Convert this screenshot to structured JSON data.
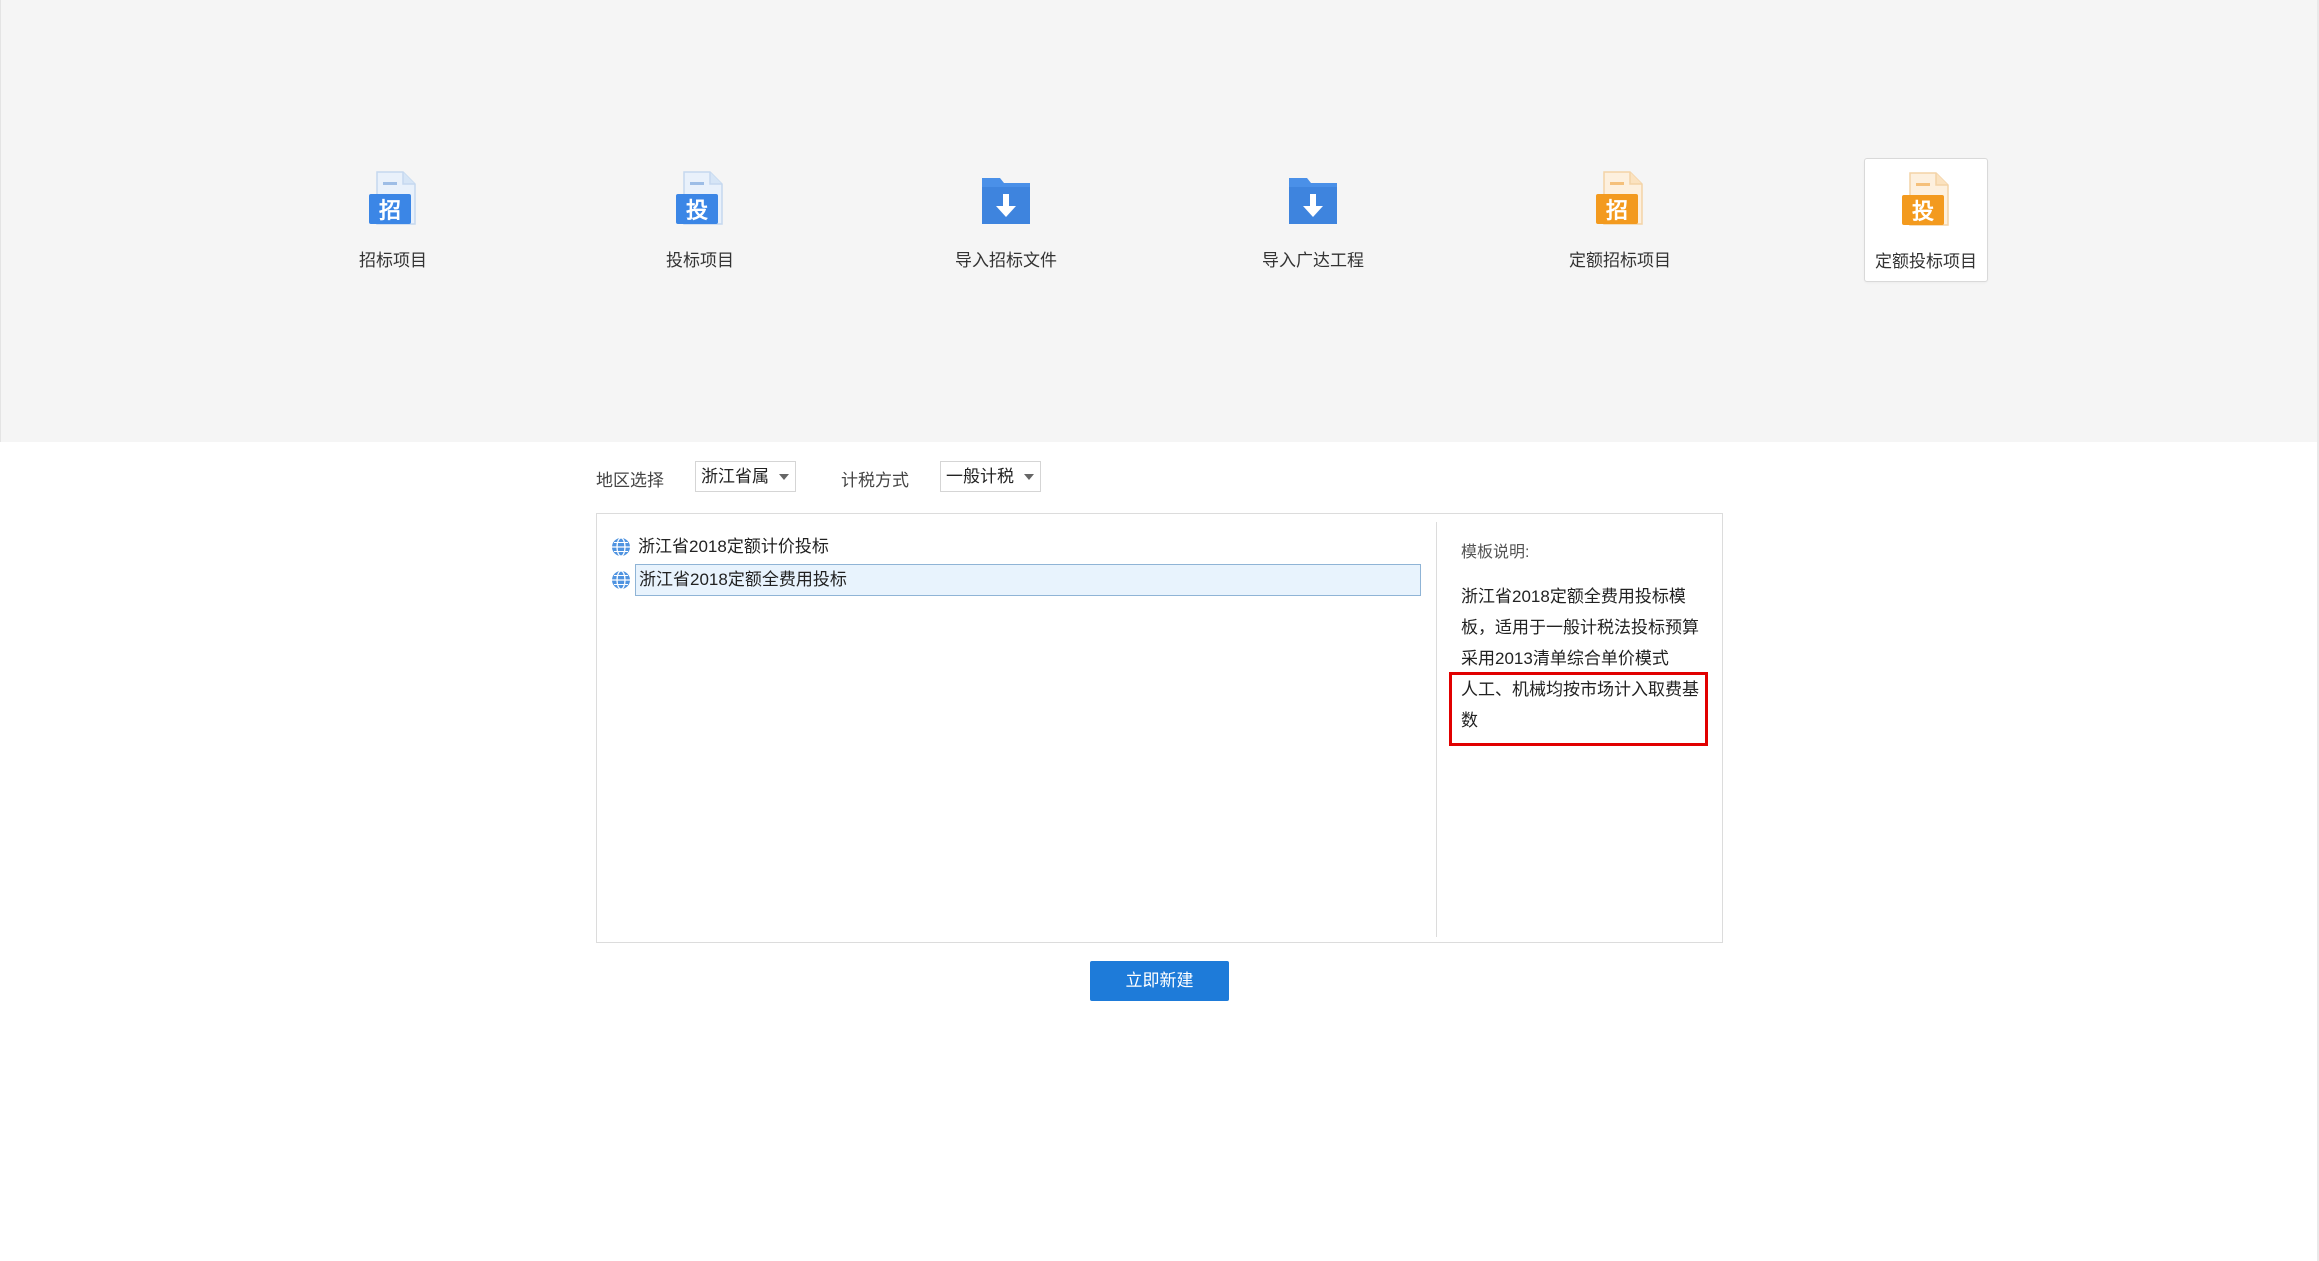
{
  "tiles": [
    {
      "label": "招标项目",
      "glyph": "招",
      "icon": "tender-project-icon",
      "color": "#3b86e6",
      "selected": false
    },
    {
      "label": "投标项目",
      "glyph": "投",
      "icon": "bid-project-icon",
      "color": "#3b86e6",
      "selected": false
    },
    {
      "label": "导入招标文件",
      "glyph": "",
      "icon": "import-tender-file-icon",
      "color": "#4a90e8",
      "selected": false
    },
    {
      "label": "导入广达工程",
      "glyph": "",
      "icon": "import-guangda-project-icon",
      "color": "#4a90e8",
      "selected": false
    },
    {
      "label": "定额招标项目",
      "glyph": "招",
      "icon": "quota-tender-project-icon",
      "color": "#f39a1e",
      "selected": false
    },
    {
      "label": "定额投标项目",
      "glyph": "投",
      "icon": "quota-bid-project-icon",
      "color": "#f39a1e",
      "selected": true
    }
  ],
  "filters": {
    "region_label": "地区选择",
    "region_value": "浙江省属",
    "tax_label": "计税方式",
    "tax_value": "一般计税"
  },
  "templates": [
    {
      "label": "浙江省2018定额计价投标",
      "selected": false
    },
    {
      "label": "浙江省2018定额全费用投标",
      "selected": true
    }
  ],
  "description": {
    "title": "模板说明:",
    "lines": [
      "浙江省2018定额全费用投标模",
      "板，适用于一般计税法投标预算",
      "采用2013清单综合单价模式",
      "人工、机械均按市场计入取费基",
      "数"
    ]
  },
  "create_button": "立即新建",
  "colors": {
    "accent": "#1e7bd9",
    "highlight": "#e10000",
    "selection_bg": "#e8f3fd"
  }
}
